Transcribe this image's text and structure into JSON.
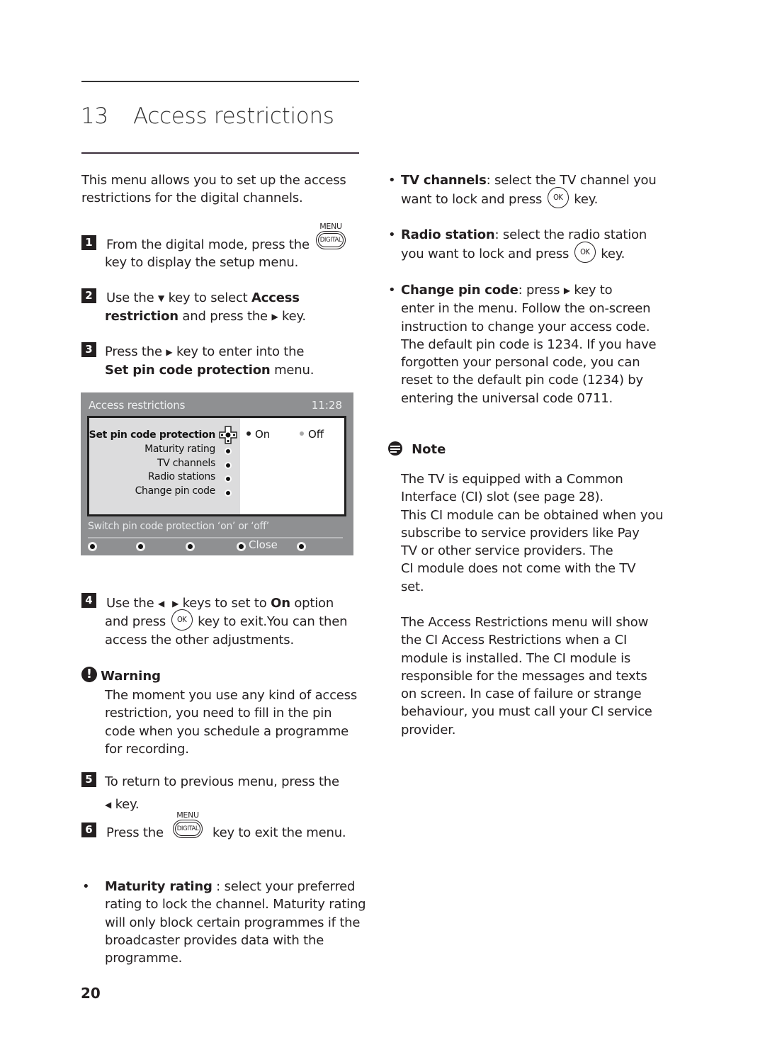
{
  "chapter": {
    "number": "13",
    "title": "Access restrictions"
  },
  "intro": "This menu allows you to set up the access restrictions for the digital channels.",
  "keys": {
    "menu_label": "MENU",
    "digital_label": "DIGITAL",
    "ok_label": "OK",
    "right_arrow": "▶",
    "left_arrow": "◀",
    "down_arrow": "▼"
  },
  "steps": [
    {
      "num": "1",
      "line1_pre": "From the digital mode, press the",
      "line2": "key to display the setup menu."
    },
    {
      "num": "2",
      "pre": "Use the",
      "mid": "key to select",
      "bold1": "Access",
      "bold2": "restriction",
      "post": "and press the",
      "end": "key."
    },
    {
      "num": "3",
      "pre": "Press the",
      "mid": "key to enter into the",
      "bold": "Set pin code protection",
      "post": "menu."
    },
    {
      "num": "4",
      "pre": "Use the",
      "mid": "keys to set to",
      "bold": "On",
      "post": "option",
      "line2_pre": "and press",
      "line2_post": "key to exit.You can then",
      "line3": "access the other adjustments."
    },
    {
      "num": "5",
      "line1": "To return to previous menu, press the",
      "line2": "key."
    },
    {
      "num": "6",
      "pre": "Press the",
      "post": "key to exit the menu."
    }
  ],
  "tv_menu": {
    "title": "Access restrictions",
    "time": "11:28",
    "items": [
      {
        "label": "Set pin code protection",
        "selected": true
      },
      {
        "label": "Maturity rating",
        "selected": false
      },
      {
        "label": "TV channels",
        "selected": false
      },
      {
        "label": "Radio stations",
        "selected": false
      },
      {
        "label": "Change pin code",
        "selected": false
      }
    ],
    "options": [
      {
        "label": "On",
        "active": true
      },
      {
        "label": "Off",
        "active": false
      }
    ],
    "hint": "Switch pin code protection ‘on’ or ‘off’",
    "footer": {
      "close_label": "Close"
    }
  },
  "warning": {
    "title": "Warning",
    "lines": [
      "The moment you use any kind of access",
      "restriction, you need to fill in the pin",
      "code when you schedule a programme",
      "for recording."
    ]
  },
  "bullets_left": [
    {
      "bold": "Maturity rating",
      "sep": " : ",
      "lines": [
        "select your preferred",
        "rating to lock the channel. Maturity rating",
        "will only block certain programmes if the",
        "broadcaster provides data with the",
        "programme."
      ]
    }
  ],
  "bullets_right": [
    {
      "bold": "TV channels",
      "text1": ": select the TV channel you",
      "text2_pre": "want to lock and press",
      "text2_post": "key."
    },
    {
      "bold": "Radio station",
      "text1": ": select the radio station",
      "text2_pre": "you want to lock and press",
      "text2_post": "key."
    },
    {
      "bold": "Change pin code",
      "text1_pre": ": press",
      "text1_post": "key to",
      "lines": [
        "enter in the menu. Follow the on-screen",
        "instruction to change your access code.",
        "The default pin code is 1234. If you have",
        "forgotten your personal code, you can",
        "reset to the default pin code (1234) by",
        "entering the universal code 0711."
      ]
    }
  ],
  "note": {
    "title": "Note",
    "para1": [
      "The TV is equipped with a Common",
      "Interface (CI) slot (see page 28).",
      "This CI module can be obtained when you",
      "subscribe to service providers like Pay",
      "TV or other service providers. The",
      "CI module does not come with the TV",
      "set."
    ],
    "para2": [
      "The Access Restrictions menu will show",
      "the CI Access Restrictions when a CI",
      "module is installed. The CI module is",
      "responsible for the messages and texts",
      "on screen. In case of failure or strange",
      "behaviour, you must call your CI service",
      "provider."
    ]
  },
  "page_number": "20"
}
